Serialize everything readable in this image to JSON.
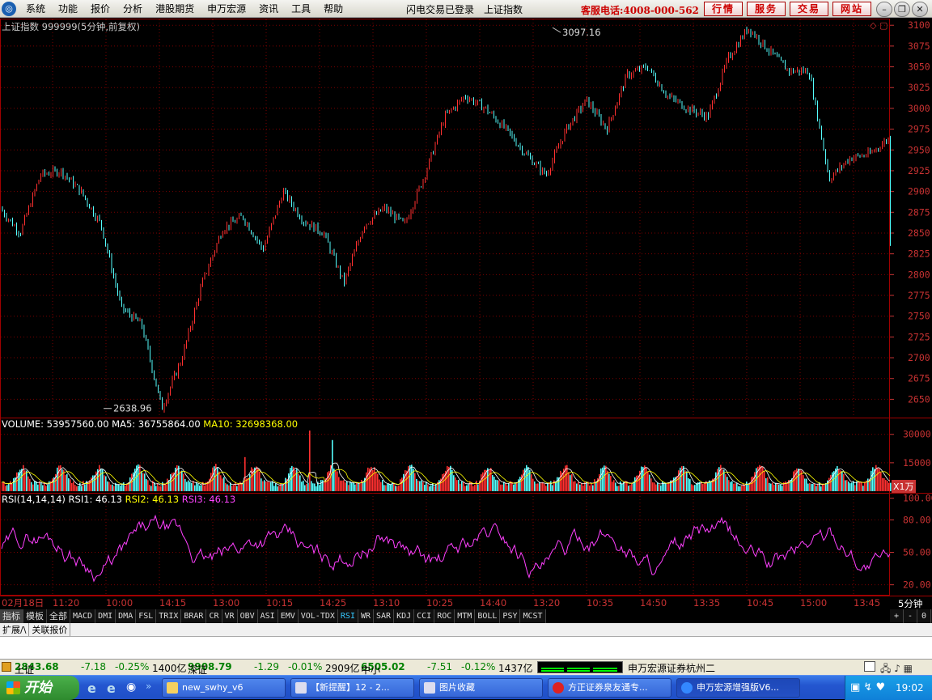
{
  "menu": [
    "系统",
    "功能",
    "报价",
    "分析",
    "港股期货",
    "申万宏源",
    "资讯",
    "工具",
    "帮助"
  ],
  "login_status": "闪电交易已登录",
  "index_name_title": "上证指数",
  "hotline": "客服电话:4008-000-562",
  "service_buttons": [
    "行情",
    "服务",
    "交易",
    "网站"
  ],
  "chart_header": "上证指数 999999(5分钟,前复权)",
  "volume_header": {
    "volume": "VOLUME: 53957560.00",
    "ma5": "MA5: 36755864.00",
    "ma10": "MA10: 32698368.00"
  },
  "rsi_header": {
    "name": "RSI(14,14,14)",
    "rsi1": "RSI1: 46.13",
    "rsi2": "RSI2: 46.13",
    "rsi3": "RSI3: 46.13"
  },
  "volume_unit": "X1万",
  "period": "5分钟",
  "colors": {
    "price_axis": "#c83232",
    "up": "#ff3030",
    "down": "#54fcfc",
    "ma5": "#ffffff",
    "ma10": "#ffff00",
    "rsi1": "#ffffff",
    "rsi2": "#ffff00",
    "rsi3": "#ff40ff",
    "grid": "#7a0000"
  },
  "chart_data": [
    {
      "type": "line",
      "name": "price",
      "y_ticks": [
        3100,
        3075,
        3050,
        3025,
        3000,
        2975,
        2950,
        2925,
        2900,
        2875,
        2850,
        2825,
        2800,
        2775,
        2750,
        2725,
        2700,
        2675,
        2650
      ],
      "ylim": [
        2628,
        3108
      ],
      "high_label": "3097.16",
      "low_label": "2638.96",
      "x_ticks": [
        "02月18日",
        "11:20",
        "10:00",
        "14:15",
        "13:00",
        "10:15",
        "14:25",
        "13:10",
        "10:25",
        "14:40",
        "13:20",
        "10:35",
        "14:50",
        "13:35",
        "10:45",
        "15:00",
        "13:45"
      ],
      "x_key": [
        0,
        25,
        50,
        75,
        100,
        125,
        150,
        175,
        200,
        225,
        250,
        275,
        300,
        325,
        350,
        375,
        400,
        425,
        450,
        475,
        500,
        525,
        550,
        575,
        600,
        625,
        650,
        675,
        700,
        725,
        750,
        775,
        800,
        825,
        850,
        875,
        900,
        925,
        950,
        975,
        1000,
        1025,
        1050,
        1075,
        1100
      ],
      "y_key": [
        2880,
        2850,
        2920,
        2925,
        2900,
        2860,
        2760,
        2740,
        2638.96,
        2700,
        2790,
        2855,
        2870,
        2830,
        2900,
        2865,
        2850,
        2790,
        2860,
        2880,
        2860,
        2920,
        2990,
        3015,
        3000,
        2975,
        2945,
        2920,
        2975,
        3010,
        2975,
        3040,
        3050,
        3015,
        3000,
        2990,
        3060,
        3097.16,
        3070,
        3045,
        3045,
        2915,
        2940,
        2945,
        2965,
        2940,
        2930,
        2990,
        3000,
        2965,
        2860,
        2830,
        2840,
        2810,
        2830,
        2830,
        2840
      ]
    },
    {
      "type": "bar",
      "name": "volume",
      "y_ticks": [
        30000,
        15000
      ],
      "ylim": [
        0,
        38000
      ],
      "peak": 32000
    },
    {
      "type": "line",
      "name": "rsi",
      "y_ticks": [
        100,
        80,
        50,
        20
      ],
      "ylim": [
        10,
        105
      ]
    }
  ],
  "tabs": [
    "指标",
    "模板",
    "全部",
    "MACD",
    "DMI",
    "DMA",
    "FSL",
    "TRIX",
    "BRAR",
    "CR",
    "VR",
    "OBV",
    "ASI",
    "EMV",
    "VOL-TDX",
    "RSI",
    "WR",
    "SAR",
    "KDJ",
    "CCI",
    "ROC",
    "MTM",
    "BOLL",
    "PSY",
    "MCST"
  ],
  "tab_right": [
    "+",
    "-",
    "0"
  ],
  "ext_tabs": [
    "扩展/\\",
    "关联报价"
  ],
  "status": {
    "sh_label": "上证",
    "sh_value": "2843.68",
    "sh_chg": "-7.18",
    "sh_pct": "-0.25%",
    "sh_amt": "1400亿",
    "sz_label": "深证",
    "sz_value": "9908.79",
    "sz_chg": "-1.29",
    "sz_pct": "-0.01%",
    "sz_amt": "2909亿",
    "zx_label": "中小",
    "zx_value": "6505.02",
    "zx_chg": "-7.51",
    "zx_pct": "-0.12%",
    "zx_amt": "1437亿",
    "branch": "申万宏源证券杭州二"
  },
  "taskbar": {
    "start": "开始",
    "items": [
      "new_swhy_v6",
      "【新提醒】12 - 2...",
      "图片收藏",
      "方正证券泉友通专...",
      "申万宏源增强版V6..."
    ],
    "clock": "19:02"
  }
}
